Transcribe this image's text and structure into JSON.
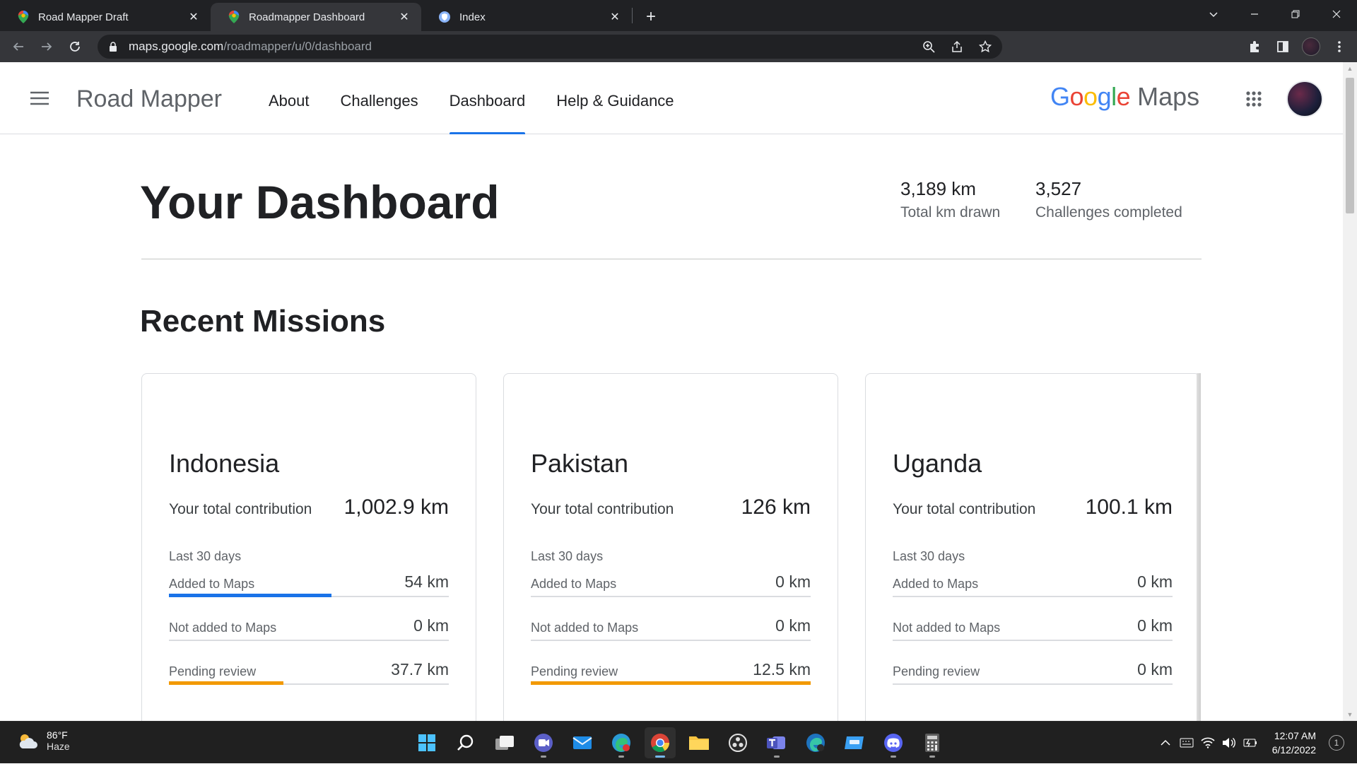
{
  "browser": {
    "tabs": [
      {
        "title": "Road Mapper Draft",
        "active": false
      },
      {
        "title": "Roadmapper Dashboard",
        "active": true
      },
      {
        "title": "Index",
        "active": false
      }
    ],
    "url_host": "maps.google.com",
    "url_path": "/roadmapper/u/0/dashboard"
  },
  "app": {
    "brand": "Road Mapper",
    "nav": [
      {
        "label": "About",
        "active": false
      },
      {
        "label": "Challenges",
        "active": false
      },
      {
        "label": "Dashboard",
        "active": true
      },
      {
        "label": "Help & Guidance",
        "active": false
      }
    ],
    "logo_google": "Google",
    "logo_maps": "Maps"
  },
  "dashboard": {
    "title": "Your Dashboard",
    "stats": [
      {
        "value": "3,189 km",
        "label": "Total km drawn"
      },
      {
        "value": "3,527",
        "label": "Challenges completed"
      }
    ]
  },
  "missions": {
    "title": "Recent Missions",
    "cards": [
      {
        "country": "Indonesia",
        "contribution_label": "Your total contribution",
        "contribution_value": "1,002.9 km",
        "period": "Last 30 days",
        "rows": [
          {
            "label": "Added to Maps",
            "value": "54 km",
            "fill": 0.58,
            "color": "#1a73e8"
          },
          {
            "label": "Not added to Maps",
            "value": "0 km",
            "fill": 0,
            "color": "#d93025"
          },
          {
            "label": "Pending review",
            "value": "37.7 km",
            "fill": 0.41,
            "color": "#f29900"
          }
        ]
      },
      {
        "country": "Pakistan",
        "contribution_label": "Your total contribution",
        "contribution_value": "126 km",
        "period": "Last 30 days",
        "rows": [
          {
            "label": "Added to Maps",
            "value": "0 km",
            "fill": 0,
            "color": "#1a73e8"
          },
          {
            "label": "Not added to Maps",
            "value": "0 km",
            "fill": 0,
            "color": "#d93025"
          },
          {
            "label": "Pending review",
            "value": "12.5 km",
            "fill": 1.0,
            "color": "#f29900"
          }
        ]
      },
      {
        "country": "Uganda",
        "contribution_label": "Your total contribution",
        "contribution_value": "100.1 km",
        "period": "Last 30 days",
        "rows": [
          {
            "label": "Added to Maps",
            "value": "0 km",
            "fill": 0,
            "color": "#1a73e8"
          },
          {
            "label": "Not added to Maps",
            "value": "0 km",
            "fill": 0,
            "color": "#d93025"
          },
          {
            "label": "Pending review",
            "value": "0 km",
            "fill": 0,
            "color": "#f29900"
          }
        ]
      }
    ]
  },
  "taskbar": {
    "weather_temp": "86°F",
    "weather_cond": "Haze",
    "time": "12:07 AM",
    "date": "6/12/2022",
    "notification_count": "1",
    "apps": [
      "start-icon",
      "search-icon",
      "task-view-icon",
      "meet-icon",
      "mail-icon",
      "edge-beta-icon",
      "chrome-icon",
      "file-explorer-icon",
      "obs-icon",
      "teams-icon",
      "edge-dev-icon",
      "outlook-icon",
      "discord-icon",
      "calculator-icon"
    ]
  }
}
